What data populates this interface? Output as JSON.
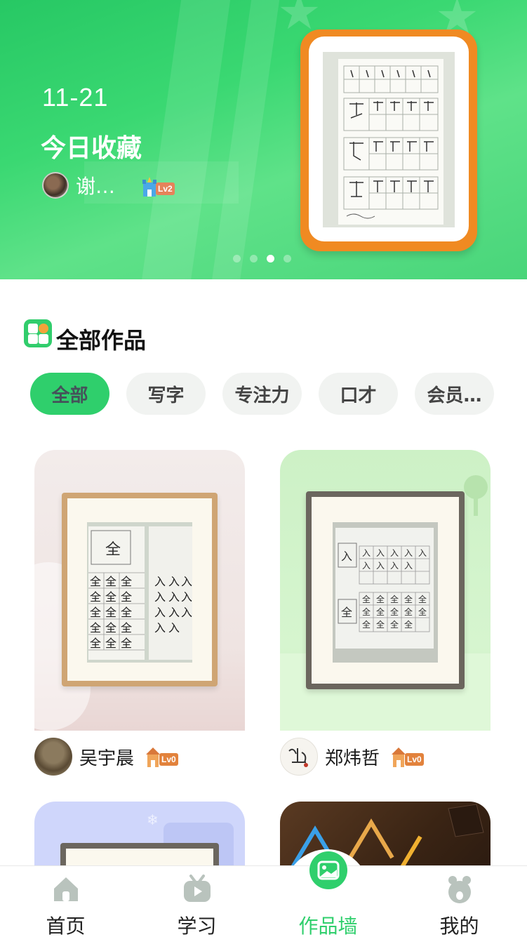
{
  "banner": {
    "date": "11-21",
    "title": "今日收藏",
    "user": {
      "name": "谢…",
      "level": "Lv2"
    },
    "carousel": {
      "count": 4,
      "active_index": 2
    }
  },
  "section": {
    "title": "全部作品"
  },
  "filters": [
    {
      "label": "全部",
      "active": true
    },
    {
      "label": "写字",
      "active": false
    },
    {
      "label": "专注力",
      "active": false
    },
    {
      "label": "口才",
      "active": false
    },
    {
      "label": "会员…",
      "active": false
    }
  ],
  "works": [
    {
      "user": "吴宇晨",
      "level": "Lv0"
    },
    {
      "user": "郑炜哲",
      "level": "Lv0"
    },
    {
      "user": "",
      "level": ""
    },
    {
      "user": "",
      "level": ""
    }
  ],
  "tabbar": {
    "items": [
      {
        "label": "首页",
        "icon": "home-icon",
        "active": false
      },
      {
        "label": "学习",
        "icon": "tv-icon",
        "active": false
      },
      {
        "label": "作品墙",
        "icon": "gallery-icon",
        "active": true
      },
      {
        "label": "我的",
        "icon": "bear-icon",
        "active": false
      }
    ]
  },
  "colors": {
    "accent": "#2fcf6c",
    "frame_orange": "#f08a22",
    "inactive_icon": "#b9c3bd"
  }
}
